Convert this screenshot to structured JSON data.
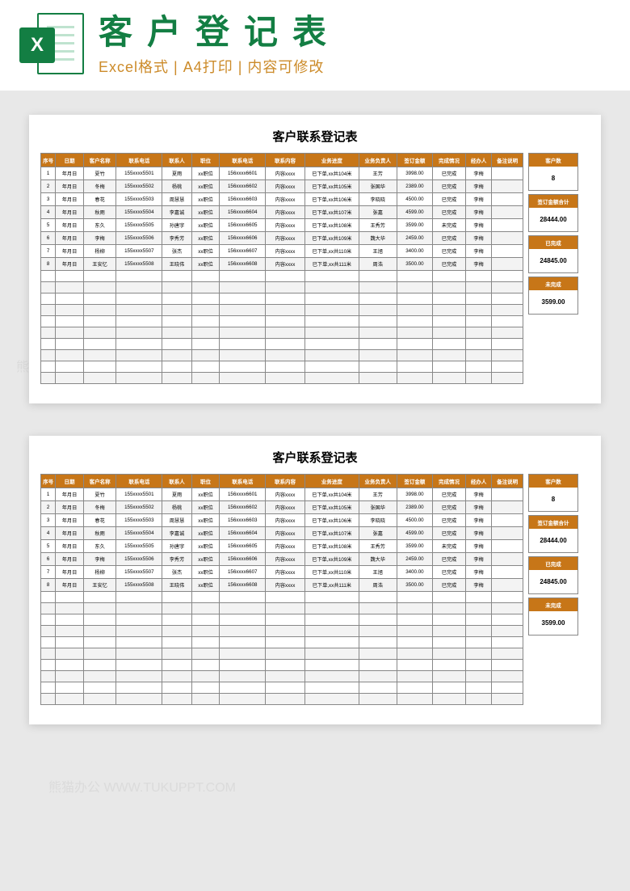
{
  "header": {
    "icon_letter": "X",
    "title": "客户登记表",
    "subtitle_parts": [
      "Excel格式",
      "A4打印",
      "内容可修改"
    ],
    "subtitle_separator": " | "
  },
  "sheet_title": "客户联系登记表",
  "columns": [
    "序号",
    "日期",
    "客户名称",
    "联系电话",
    "联系人",
    "职位",
    "联系电话",
    "联系内容",
    "业务进度",
    "业务负责人",
    "签订金额",
    "完成情况",
    "经办人",
    "备注说明"
  ],
  "rows": [
    {
      "seq": "1",
      "date": "年月日",
      "name": "夏竹",
      "tel1": "155xxxx5501",
      "person": "夏雨",
      "pos": "xx职位",
      "tel2": "156xxxx6601",
      "content": "内容xxxx",
      "progress": "已下单,xx共104米",
      "resp": "王芳",
      "amount": "3998.00",
      "done": "已完成",
      "op": "李梅",
      "note": ""
    },
    {
      "seq": "2",
      "date": "年月日",
      "name": "冬梅",
      "tel1": "155xxxx5502",
      "person": "杨桃",
      "pos": "xx职位",
      "tel2": "156xxxx6602",
      "content": "内容xxxx",
      "progress": "已下单,xx共105米",
      "resp": "张国华",
      "amount": "2389.00",
      "done": "已完成",
      "op": "李梅",
      "note": ""
    },
    {
      "seq": "3",
      "date": "年月日",
      "name": "春花",
      "tel1": "155xxxx5503",
      "person": "周慧慧",
      "pos": "xx职位",
      "tel2": "156xxxx6603",
      "content": "内容xxxx",
      "progress": "已下单,xx共106米",
      "resp": "李晓晓",
      "amount": "4500.00",
      "done": "已完成",
      "op": "李梅",
      "note": ""
    },
    {
      "seq": "4",
      "date": "年月日",
      "name": "秋雨",
      "tel1": "155xxxx5504",
      "person": "李嘉诚",
      "pos": "xx职位",
      "tel2": "156xxxx6604",
      "content": "内容xxxx",
      "progress": "已下单,xx共107米",
      "resp": "张嘉",
      "amount": "4599.00",
      "done": "已完成",
      "op": "李梅",
      "note": ""
    },
    {
      "seq": "5",
      "date": "年月日",
      "name": "东久",
      "tel1": "155xxxx5505",
      "person": "孙唐宇",
      "pos": "xx职位",
      "tel2": "156xxxx6605",
      "content": "内容xxxx",
      "progress": "已下单,xx共108米",
      "resp": "王秀芳",
      "amount": "3599.00",
      "done": "未完成",
      "op": "李梅",
      "note": ""
    },
    {
      "seq": "6",
      "date": "年月日",
      "name": "李梅",
      "tel1": "155xxxx5506",
      "person": "李秀芳",
      "pos": "xx职位",
      "tel2": "156xxxx6606",
      "content": "内容xxxx",
      "progress": "已下单,xx共109米",
      "resp": "魏大华",
      "amount": "2459.00",
      "done": "已完成",
      "op": "李梅",
      "note": ""
    },
    {
      "seq": "7",
      "date": "年月日",
      "name": "杨柳",
      "tel1": "155xxxx5507",
      "person": "张杰",
      "pos": "xx职位",
      "tel2": "156xxxx6607",
      "content": "内容xxxx",
      "progress": "已下单,xx共110米",
      "resp": "王旭",
      "amount": "3400.00",
      "done": "已完成",
      "op": "李梅",
      "note": ""
    },
    {
      "seq": "8",
      "date": "年月日",
      "name": "王安忆",
      "tel1": "155xxxx5508",
      "person": "王晓伟",
      "pos": "xx职位",
      "tel2": "156xxxx6608",
      "content": "内容xxxx",
      "progress": "已下单,xx共111米",
      "resp": "周浩",
      "amount": "3500.00",
      "done": "已完成",
      "op": "李梅",
      "note": ""
    }
  ],
  "empty_rows": 10,
  "summary": [
    {
      "label": "客户数",
      "value": "8"
    },
    {
      "label": "签订金额合计",
      "value": "28444.00"
    },
    {
      "label": "已完成",
      "value": "24845.00"
    },
    {
      "label": "未完成",
      "value": "3599.00"
    }
  ],
  "watermark_text": "熊猫办公 WWW.TUKUPPT.COM"
}
